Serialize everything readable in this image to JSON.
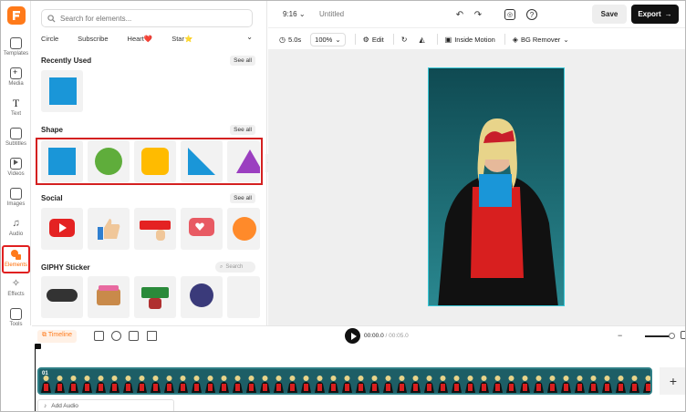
{
  "rail": {
    "items": [
      {
        "label": "Templates",
        "icon": "templates-icon"
      },
      {
        "label": "Media",
        "icon": "media-icon"
      },
      {
        "label": "Text",
        "icon": "text-icon"
      },
      {
        "label": "Subtitles",
        "icon": "subtitles-icon"
      },
      {
        "label": "Videos",
        "icon": "videos-icon"
      },
      {
        "label": "Images",
        "icon": "images-icon"
      },
      {
        "label": "Audio",
        "icon": "audio-icon"
      },
      {
        "label": "Elements",
        "icon": "elements-icon",
        "active": true
      },
      {
        "label": "Effects",
        "icon": "effects-icon"
      },
      {
        "label": "Tools",
        "icon": "tools-icon"
      }
    ]
  },
  "panel": {
    "search_placeholder": "Search for elements...",
    "chips": [
      "Circle",
      "Subscribe",
      "Heart❤️",
      "Star⭐"
    ],
    "sections": {
      "recent": {
        "title": "Recently Used",
        "see_all": "See all"
      },
      "shape": {
        "title": "Shape",
        "see_all": "See all"
      },
      "social": {
        "title": "Social",
        "see_all": "See all"
      },
      "giphy": {
        "title": "GIPHY Sticker",
        "search_placeholder": "Search"
      }
    }
  },
  "topbar": {
    "aspect": "9:16",
    "project_name": "Untitled",
    "save_label": "Save",
    "export_label": "Export"
  },
  "toolbar": {
    "duration": "5.0s",
    "zoom": "100%",
    "edit": "Edit",
    "inside_motion": "Inside Motion",
    "bg_remover": "BG Remover"
  },
  "timeline": {
    "label": "Timeline",
    "current": "00:00.0",
    "total": "/ 00:05.0",
    "track_number": "01",
    "add_audio": "Add Audio"
  },
  "colors": {
    "accent": "#ff7a1a",
    "shape_blue": "#1a96d8",
    "shape_green": "#5fad3b",
    "shape_yellow": "#ffbb00",
    "shape_purple": "#9b3fc0",
    "highlight_red": "#d42020"
  }
}
